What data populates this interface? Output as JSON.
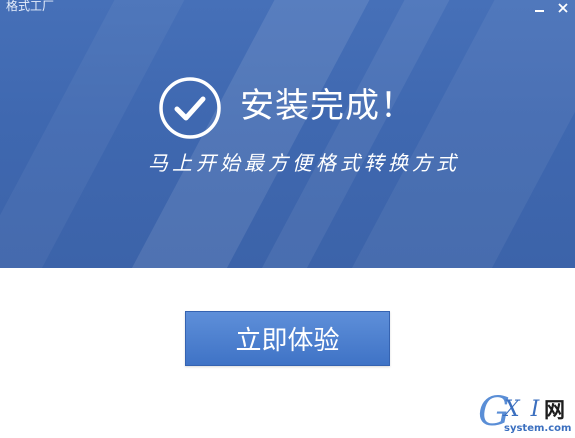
{
  "window": {
    "title": "格式工厂",
    "minimize_icon": "minimize-icon",
    "close_icon": "close-icon"
  },
  "hero": {
    "status_icon": "check-circle-icon",
    "title": "安装完成！",
    "subtitle": "马上开始最方便格式转换方式"
  },
  "actions": {
    "start_label": "立即体验"
  },
  "watermark": {
    "g": "G",
    "xi": "X I",
    "wang": "网",
    "domain": "system.com"
  },
  "colors": {
    "hero_bg": "#4169b2",
    "button_bg": "#4a7ccc",
    "text_on_blue": "#ffffff"
  }
}
